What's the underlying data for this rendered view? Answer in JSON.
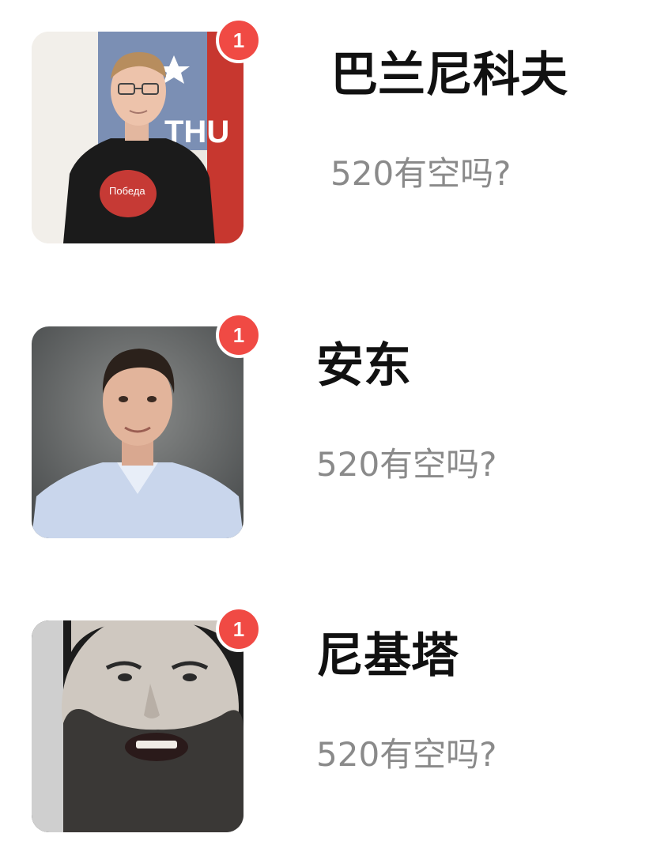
{
  "conversations": [
    {
      "contact_name": "巴兰尼科夫",
      "last_message": "520有空吗?",
      "unread_count": "1",
      "avatar": "photo-man-black-tshirt-glasses"
    },
    {
      "contact_name": "安东",
      "last_message": "520有空吗?",
      "unread_count": "1",
      "avatar": "photo-man-light-blue-shirt"
    },
    {
      "contact_name": "尼基塔",
      "last_message": "520有空吗?",
      "unread_count": "1",
      "avatar": "photo-bearded-man-closeup"
    }
  ],
  "colors": {
    "badge": "#f04a44",
    "name": "#111111",
    "message": "#8a8a8a",
    "background": "#ffffff"
  }
}
